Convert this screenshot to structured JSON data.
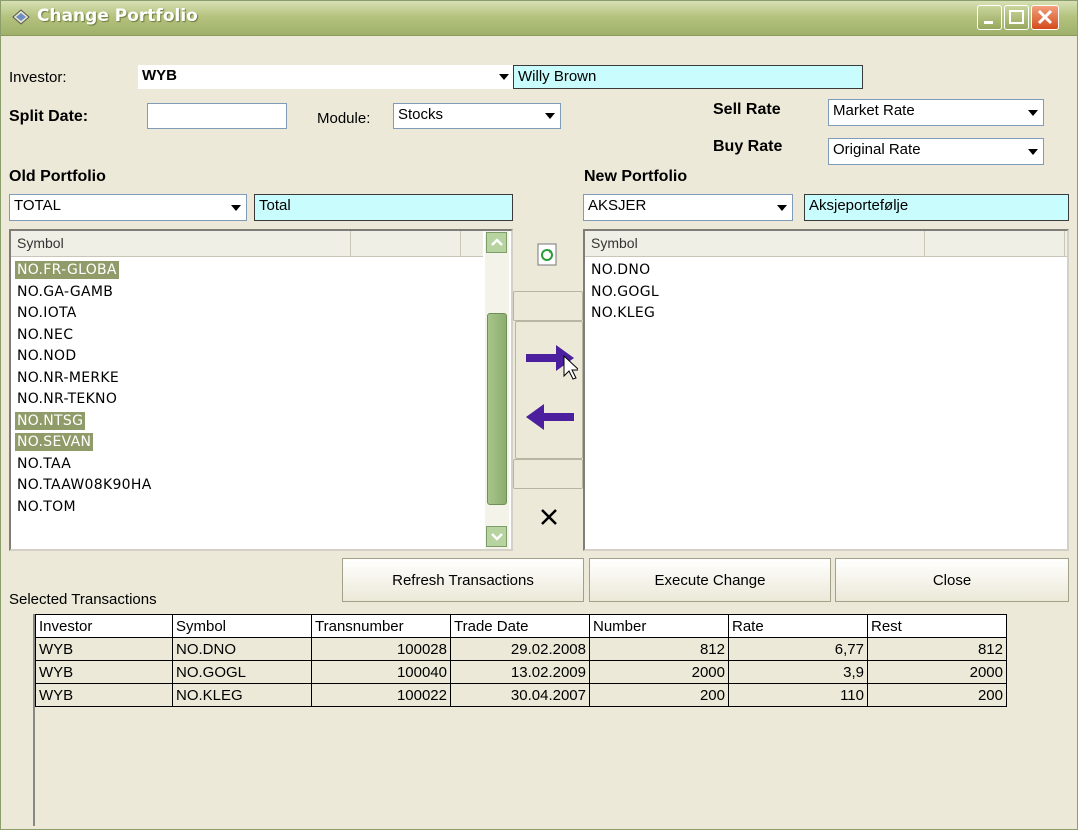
{
  "window": {
    "title": "Change Portfolio",
    "icon": "portfolio-icon"
  },
  "investor": {
    "label": "Investor:",
    "code": "WYB",
    "name": "Willy Brown"
  },
  "split_date": {
    "label": "Split Date:",
    "value": ""
  },
  "module": {
    "label": "Module:",
    "value": "Stocks"
  },
  "rates": {
    "sell_label": "Sell Rate",
    "sell_value": "Market Rate",
    "buy_label": "Buy Rate",
    "buy_value": "Original Rate"
  },
  "old_portfolio": {
    "heading": "Old Portfolio",
    "code": "TOTAL",
    "name": "Total",
    "column": "Symbol",
    "items": [
      {
        "symbol": "NO.FR-GLOBA",
        "selected": true
      },
      {
        "symbol": "NO.GA-GAMB",
        "selected": false
      },
      {
        "symbol": "NO.IOTA",
        "selected": false
      },
      {
        "symbol": "NO.NEC",
        "selected": false
      },
      {
        "symbol": "NO.NOD",
        "selected": false
      },
      {
        "symbol": "NO.NR-MERKE",
        "selected": false
      },
      {
        "symbol": "NO.NR-TEKNO",
        "selected": false
      },
      {
        "symbol": "NO.NTSG",
        "selected": true
      },
      {
        "symbol": "NO.SEVAN",
        "selected": true
      },
      {
        "symbol": "NO.TAA",
        "selected": false
      },
      {
        "symbol": "NO.TAAW08K90HA",
        "selected": false
      },
      {
        "symbol": "NO.TOM",
        "selected": false
      }
    ]
  },
  "new_portfolio": {
    "heading": "New Portfolio",
    "code": "AKSJER",
    "name": "Aksjeportefølje",
    "column": "Symbol",
    "items": [
      "NO.DNO",
      "NO.GOGL",
      "NO.KLEG"
    ]
  },
  "buttons": {
    "refresh": "Refresh Transactions",
    "execute": "Execute Change",
    "close": "Close"
  },
  "transactions": {
    "label": "Selected Transactions",
    "columns": [
      "Investor",
      "Symbol",
      "Transnumber",
      "Trade Date",
      "Number",
      "Rate",
      "Rest"
    ],
    "rows": [
      [
        "WYB",
        "NO.DNO",
        "100028",
        "29.02.2008",
        "812",
        "6,77",
        "812"
      ],
      [
        "WYB",
        "NO.GOGL",
        "100040",
        "13.02.2009",
        "2000",
        "3,9",
        "2000"
      ],
      [
        "WYB",
        "NO.KLEG",
        "100022",
        "30.04.2007",
        "200",
        "110",
        "200"
      ]
    ]
  },
  "colors": {
    "title_bar": "#a9bb72",
    "selection": "#8f9c6a",
    "cyan_field": "#c9fcfc",
    "arrow": "#4b1f9e"
  }
}
